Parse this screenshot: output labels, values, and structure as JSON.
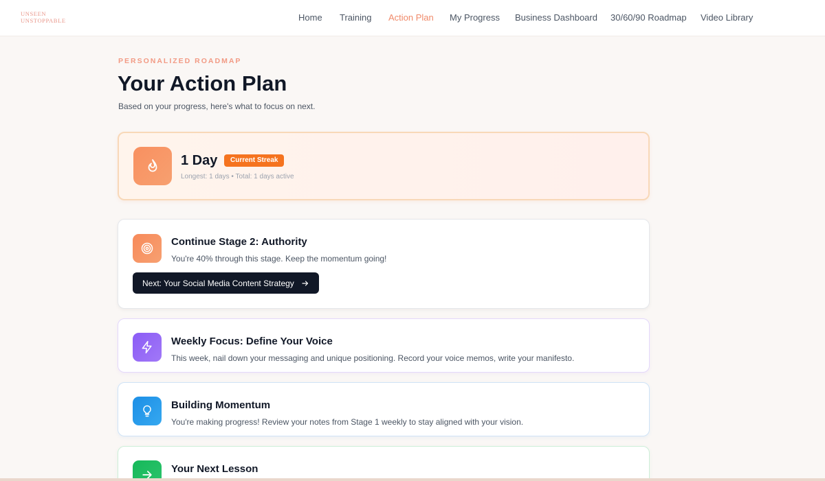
{
  "logo": {
    "line1": "UNSEEN",
    "line2": "UNSTOPPABLE"
  },
  "nav": {
    "items": [
      {
        "label": "Home"
      },
      {
        "label": "Training"
      },
      {
        "label": "Action Plan",
        "active": true
      },
      {
        "label": "My Progress"
      },
      {
        "label": "Business Dashboard"
      },
      {
        "label": "30/60/90 Roadmap"
      },
      {
        "label": "Video Library"
      }
    ]
  },
  "header": {
    "eyebrow": "PERSONALIZED ROADMAP",
    "title": "Your Action Plan",
    "subtitle": "Based on your progress, here's what to focus on next."
  },
  "streak": {
    "icon": "flame-icon",
    "value": "1 Day",
    "badge": "Current Streak",
    "meta": "Longest: 1 days • Total: 1 days active"
  },
  "cards": {
    "stage": {
      "icon": "target-icon",
      "title": "Continue Stage 2: Authority",
      "description": "You're 40% through this stage. Keep the momentum going!",
      "button": "Next: Your Social Media Content Strategy"
    },
    "weekly": {
      "icon": "lightning-icon",
      "title": "Weekly Focus: Define Your Voice",
      "description": "This week, nail down your messaging and unique positioning. Record your voice memos, write your manifesto."
    },
    "momentum": {
      "icon": "lightbulb-icon",
      "title": "Building Momentum",
      "description": "You're making progress! Review your notes from Stage 1 weekly to stay aligned with your vision."
    },
    "lesson": {
      "icon": "arrow-right-icon",
      "title": "Your Next Lesson"
    }
  },
  "colors": {
    "accent": "#f08a6a",
    "streak_badge": "#f5731f",
    "button_dark": "#111827"
  }
}
